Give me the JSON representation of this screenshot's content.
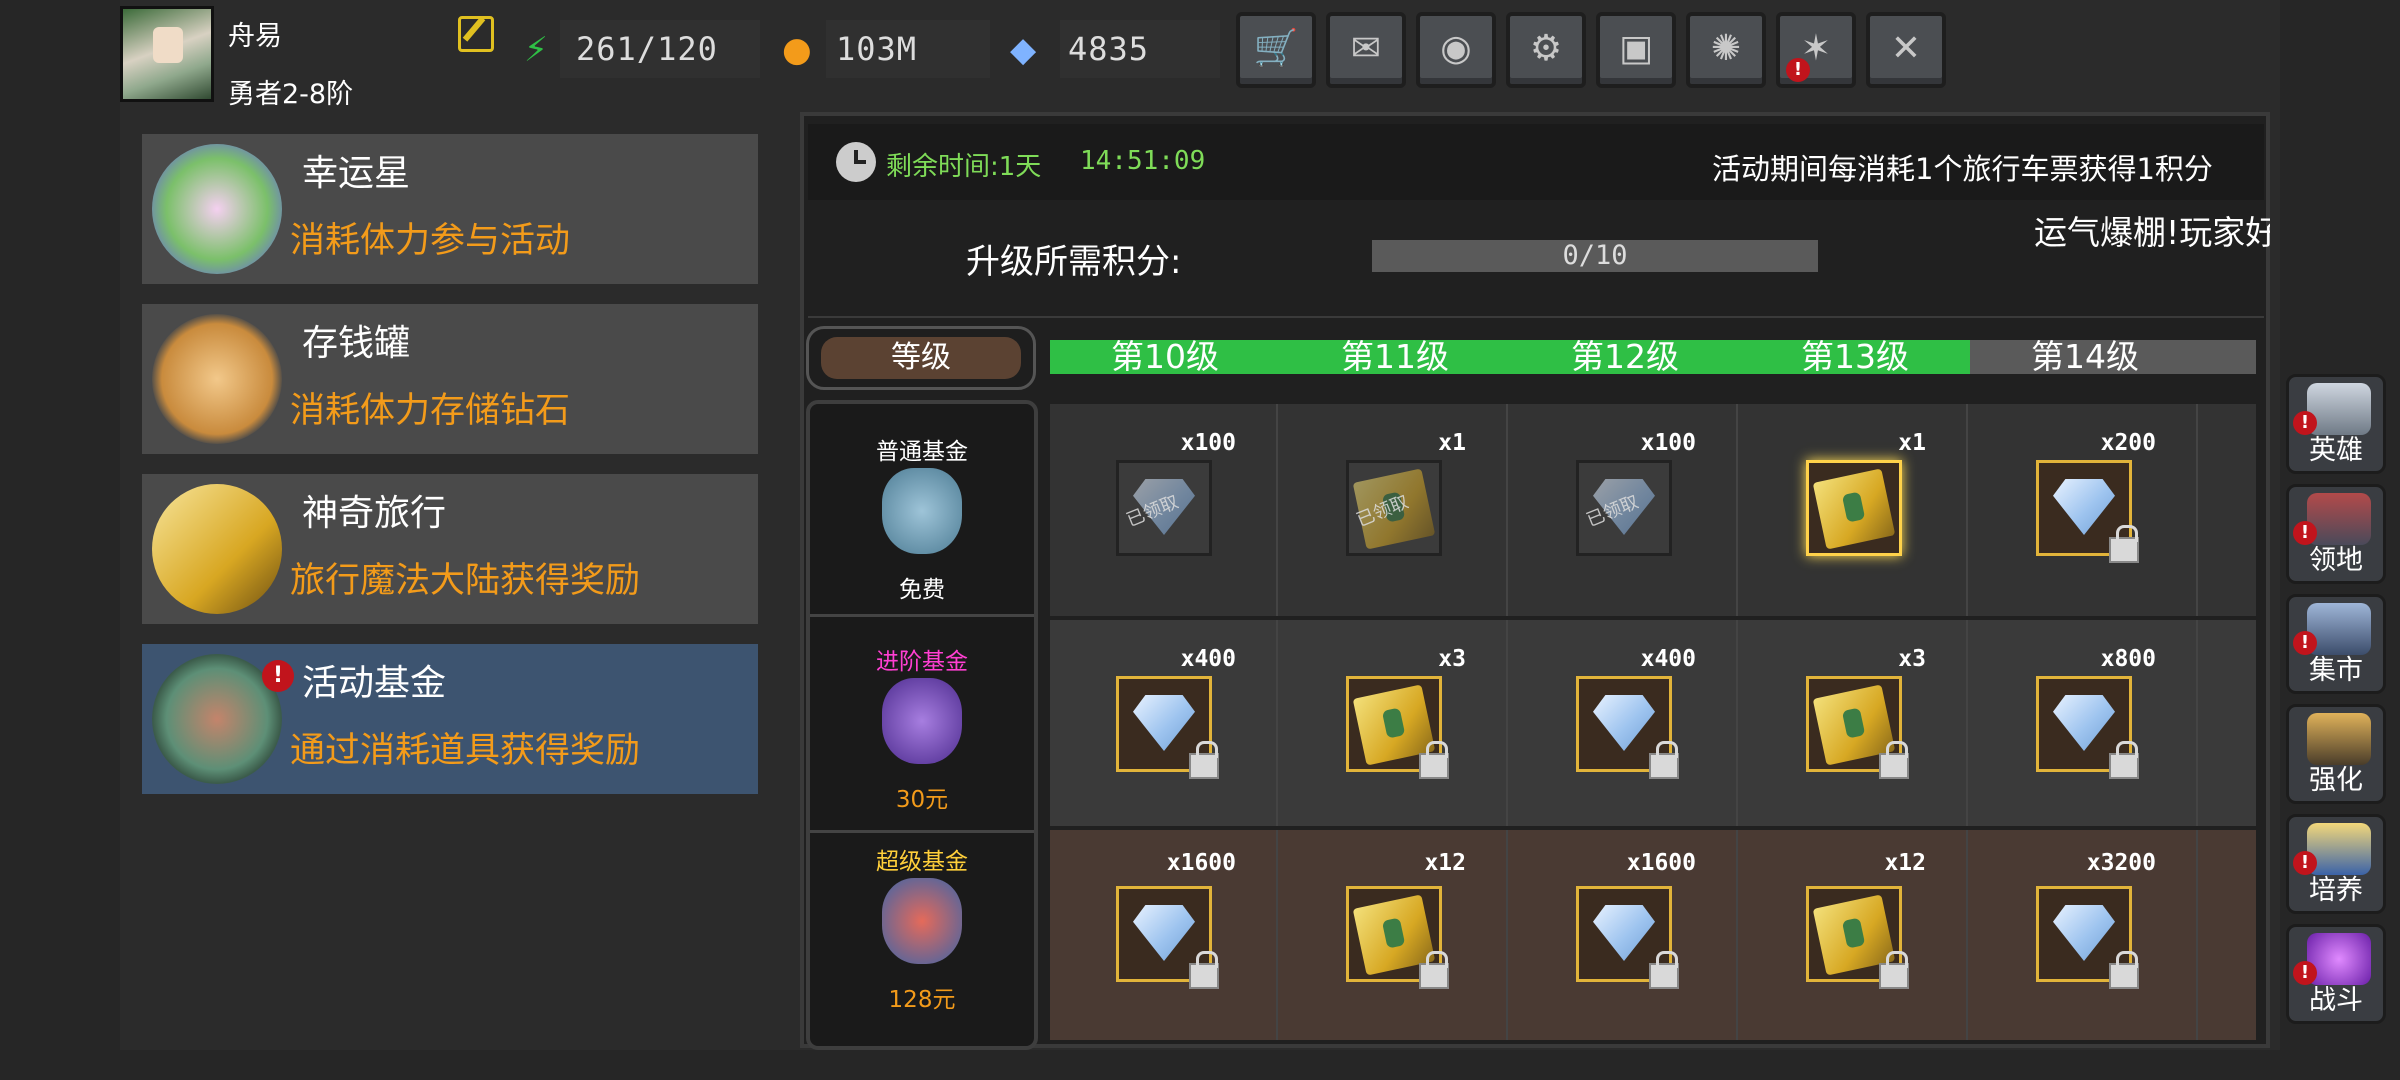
{
  "player": {
    "name": "舟易",
    "rank": "勇者2-8阶"
  },
  "stats": {
    "energy": {
      "value": "261/120",
      "icon": "lightning-icon",
      "color": "#2fbf45"
    },
    "gold": {
      "value": "103M",
      "icon": "gold-coin-icon",
      "color": "#f39b1a"
    },
    "diamond": {
      "value": "4835",
      "icon": "diamond-icon",
      "color": "#7fb3ff"
    }
  },
  "toolbar": [
    {
      "name": "shop-button",
      "icon": "cart-icon",
      "badge": false
    },
    {
      "name": "mail-button",
      "icon": "mail-icon",
      "badge": false
    },
    {
      "name": "gamepad-button",
      "icon": "gamepad-icon",
      "badge": false
    },
    {
      "name": "settings-button",
      "icon": "gear-icon",
      "badge": false
    },
    {
      "name": "gift-button",
      "icon": "gift-icon",
      "badge": false
    },
    {
      "name": "lucky-wheel-button",
      "icon": "color-wheel-icon",
      "badge": false
    },
    {
      "name": "firework-button",
      "icon": "firework-icon",
      "badge": "!"
    },
    {
      "name": "battle-toolbar-button",
      "icon": "crossed-swords-icon",
      "badge": false
    }
  ],
  "menu": [
    {
      "title": "幸运星",
      "desc": "消耗体力参与活动",
      "icon": "lucky-star-icon",
      "active": false,
      "badge": ""
    },
    {
      "title": "存钱罐",
      "desc": "消耗体力存储钻石",
      "icon": "piggy-bank-icon",
      "active": false,
      "badge": ""
    },
    {
      "title": "神奇旅行",
      "desc": "旅行魔法大陆获得奖励",
      "icon": "travel-ticket-icon",
      "active": false,
      "badge": ""
    },
    {
      "title": "活动基金",
      "desc": "通过消耗道具获得奖励",
      "icon": "fund-bag-icon",
      "active": true,
      "badge": "!"
    }
  ],
  "panel": {
    "timer_label": "剩余时间:1天",
    "timer_value": "14:51:09",
    "rule": "活动期间每消耗1个旅行车票获得1积分",
    "marquee": "运气爆棚!玩家好玩不",
    "score_label": "升级所需积分:",
    "progress": {
      "current": 0,
      "max": 10,
      "text": "0/10",
      "fraction": 0.0
    },
    "grade_label": "等级",
    "levels": [
      {
        "label": "第10级",
        "reached": true
      },
      {
        "label": "第11级",
        "reached": true
      },
      {
        "label": "第12级",
        "reached": true
      },
      {
        "label": "第13级",
        "reached": true
      },
      {
        "label": "第14级",
        "reached": false
      }
    ],
    "tiers": [
      {
        "name": "普通基金",
        "price": "免费",
        "name_color": "#ffffff",
        "price_color": "#ffffff",
        "icon": "blue-bag-icon"
      },
      {
        "name": "进阶基金",
        "price": "30元",
        "name_color": "#ff3fd2",
        "price_color": "#f39b1a",
        "icon": "purple-bag-icon"
      },
      {
        "name": "超级基金",
        "price": "128元",
        "name_color": "#ffcf3a",
        "price_color": "#f39b1a",
        "icon": "red-bag-icon"
      }
    ],
    "claimed_label": "已领取",
    "rewards": [
      [
        {
          "qty": "x100",
          "item": "diamond",
          "state": "claimed"
        },
        {
          "qty": "x1",
          "item": "ticket",
          "state": "claimed"
        },
        {
          "qty": "x100",
          "item": "diamond",
          "state": "claimed"
        },
        {
          "qty": "x1",
          "item": "ticket",
          "state": "available"
        },
        {
          "qty": "x200",
          "item": "diamond",
          "state": "locked"
        }
      ],
      [
        {
          "qty": "x400",
          "item": "diamond",
          "state": "locked"
        },
        {
          "qty": "x3",
          "item": "ticket",
          "state": "locked"
        },
        {
          "qty": "x400",
          "item": "diamond",
          "state": "locked"
        },
        {
          "qty": "x3",
          "item": "ticket",
          "state": "locked"
        },
        {
          "qty": "x800",
          "item": "diamond",
          "state": "locked"
        }
      ],
      [
        {
          "qty": "x1600",
          "item": "diamond",
          "state": "locked"
        },
        {
          "qty": "x12",
          "item": "ticket",
          "state": "locked"
        },
        {
          "qty": "x1600",
          "item": "diamond",
          "state": "locked"
        },
        {
          "qty": "x12",
          "item": "ticket",
          "state": "locked"
        },
        {
          "qty": "x3200",
          "item": "diamond",
          "state": "locked"
        }
      ]
    ]
  },
  "side_nav": [
    {
      "label": "英雄",
      "icon": "helmet-icon",
      "badge": "!"
    },
    {
      "label": "领地",
      "icon": "castle-icon",
      "badge": "!"
    },
    {
      "label": "集市",
      "icon": "market-icon",
      "badge": "!"
    },
    {
      "label": "强化",
      "icon": "upgrade-crystal-icon",
      "badge": ""
    },
    {
      "label": "培养",
      "icon": "chalice-icon",
      "badge": "!"
    },
    {
      "label": "战斗",
      "icon": "portal-icon",
      "badge": "!"
    }
  ]
}
